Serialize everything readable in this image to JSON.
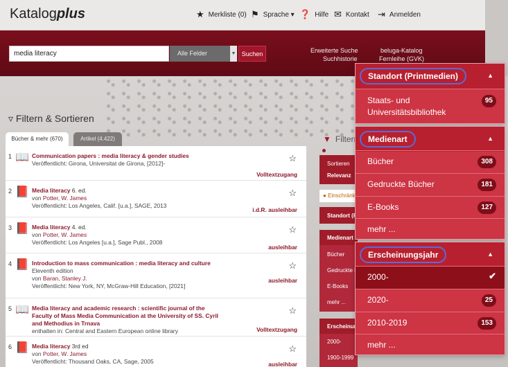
{
  "app": {
    "logo_plain": "Katalog",
    "logo_bold": "plus"
  },
  "topnav": {
    "merkliste": "Merkliste (0)",
    "sprache": "Sprache ▾",
    "hilfe": "Hilfe",
    "kontakt": "Kontakt",
    "anmelden": "Anmelden"
  },
  "search": {
    "value": "media literacy",
    "field": "Alle Felder",
    "button": "Suchen",
    "advanced": "Erweiterte Suche",
    "history": "Suchhistorie",
    "beluga": "beluga-Katalog",
    "fernleihe": "Fernleihe (GVK)"
  },
  "filter_title": "Filtern & Sortieren",
  "tabs": {
    "books": "Bücher & mehr (670)",
    "articles": "Artikel (4.422)"
  },
  "results": [
    {
      "num": "1",
      "icon": "ebook-icon",
      "title": "Communication papers : media literacy & gender studies",
      "edition": "",
      "extra": "",
      "author": "",
      "published": "Veröffentlicht: Girona, Universitat de Girona, [2012]-",
      "availability": "Volltextzugang"
    },
    {
      "num": "2",
      "icon": "book-icon",
      "title": "Media literacy",
      "edition": " 6. ed.",
      "extra": "",
      "author": "Potter, W. James",
      "published": "Veröffentlicht: Los Angeles, Calif. [u.a.], SAGE, 2013",
      "availability": "i.d.R. ausleihbar"
    },
    {
      "num": "3",
      "icon": "book-icon",
      "title": "Media literacy",
      "edition": " 4. ed.",
      "extra": "",
      "author": "Potter, W. James",
      "published": "Veröffentlicht: Los Angeles [u.a.], Sage Publ., 2008",
      "availability": "ausleihbar"
    },
    {
      "num": "4",
      "icon": "book-icon",
      "title": "Introduction to mass communication : media literacy and culture",
      "edition": "",
      "extra": "Eleventh edition",
      "author": "Baran, Stanley J.",
      "published": "Veröffentlicht: New York, NY, McGraw-Hill Education, [2021]",
      "availability": "ausleihbar"
    },
    {
      "num": "5",
      "icon": "ebook-icon",
      "title": "Media literacy and academic research : scientific journal of the Faculty of Mass Media Communication at the University of SS. Cyril and Methodius in Trnava",
      "edition": "",
      "extra": "",
      "author": "",
      "published": "enthalten in: Central and Eastern European online library",
      "availability": "Volltextzugang"
    },
    {
      "num": "6",
      "icon": "book-icon",
      "title": "Media literacy",
      "edition": " 3rd ed",
      "extra": "",
      "author": "Potter, W. James",
      "published": "Veröffentlicht: Thousand Oaks, CA, Sage, 2005",
      "availability": "ausleihbar"
    }
  ],
  "author_prefix": "von ",
  "sidebar_mid": {
    "title": "Filtern",
    "sortieren": "Sortieren",
    "relevanz": "Relevanz",
    "einschraenken": "Einschränken",
    "standort": "Standort (Printmedien)",
    "medienart": "Medienart",
    "buecher": "Bücher",
    "gedruckte": "Gedruckte Bücher",
    "ebooks": "E-Books",
    "mehr": "mehr ...",
    "erscheinung": "Erscheinungsjahr",
    "y2000": "2000-",
    "y1900": "1900-1999"
  },
  "facets": {
    "standort": {
      "title": "Standort (Printmedien)",
      "items": [
        {
          "label": "Staats- und Universitätsbibliothek",
          "count": "95"
        }
      ]
    },
    "medienart": {
      "title": "Medienart",
      "items": [
        {
          "label": "Bücher",
          "count": "308"
        },
        {
          "label": "Gedruckte Bücher",
          "count": "181"
        },
        {
          "label": "E-Books",
          "count": "127"
        }
      ],
      "more": "mehr ..."
    },
    "jahr": {
      "title": "Erscheinungsjahr",
      "items": [
        {
          "label": "2000-",
          "count": ""
        },
        {
          "label": "2020-",
          "count": "25"
        },
        {
          "label": "2010-2019",
          "count": "153"
        }
      ],
      "more": "mehr ..."
    }
  }
}
